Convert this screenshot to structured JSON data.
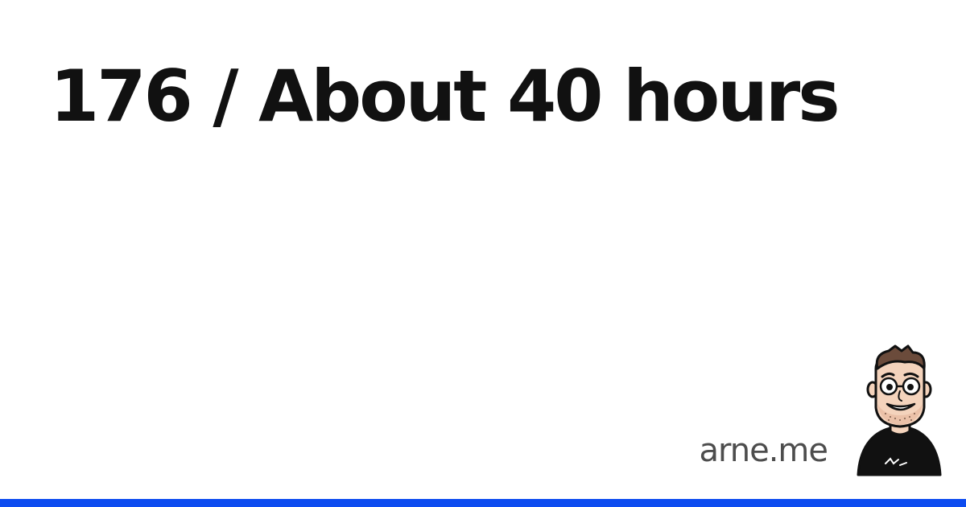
{
  "card": {
    "title": "176 / About 40 hours",
    "site": "arne.me",
    "avatar_icon": "cartoon-portrait-icon",
    "accent_color": "#0d4cf0"
  }
}
